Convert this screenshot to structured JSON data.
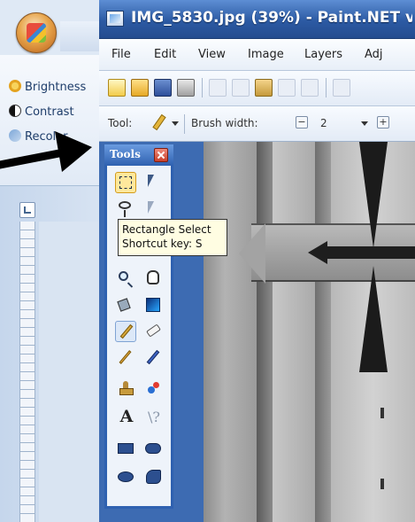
{
  "office": {
    "ribbon_items": [
      "Brightness",
      "Contrast",
      "Recolor"
    ]
  },
  "paintnet": {
    "title": "IMG_5830.jpg (39%) - Paint.NET v",
    "menu": [
      "File",
      "Edit",
      "View",
      "Image",
      "Layers",
      "Adj"
    ],
    "tool_options": {
      "tool_label": "Tool:",
      "brush_width_label": "Brush width:",
      "brush_width_value": "2",
      "minus": "−",
      "plus": "+"
    }
  },
  "tools_window": {
    "title": "Tools",
    "active_tool": "rectangle-select",
    "tools": [
      "rectangle-select",
      "move-selection",
      "lasso-select",
      "move-selected",
      "zoom",
      "pan",
      "paint-bucket",
      "gradient",
      "paintbrush",
      "eraser",
      "pencil",
      "color-picker",
      "clone-stamp",
      "recolor",
      "text",
      "line-curve",
      "rectangle",
      "rounded-rectangle",
      "ellipse",
      "freeform-shape"
    ],
    "text_tool_glyph": "A",
    "line_tool_glyph": "\\?"
  },
  "tooltip": {
    "line1": "Rectangle Select",
    "line2": "Shortcut key: S"
  },
  "colors": {
    "paintnet_frame": "#2f5fa8",
    "tools_frame": "#2f61b0",
    "tooltip_bg": "#fffde2",
    "arrow": "#000000"
  }
}
